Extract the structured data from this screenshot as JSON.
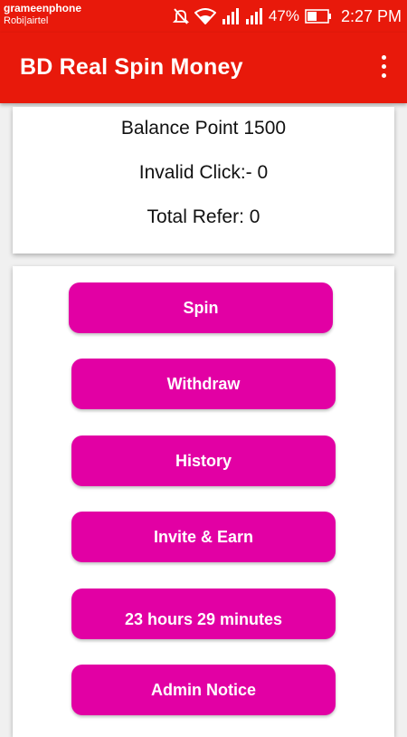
{
  "status_bar": {
    "carrier_primary": "grameenphone",
    "carrier_secondary": "Robi|airtel",
    "battery_percent": "47%",
    "time": "2:27 PM",
    "icons": [
      "mute-icon",
      "wifi-icon",
      "signal-icon",
      "signal-icon",
      "battery-icon"
    ]
  },
  "app_bar": {
    "title": "BD Real Spin Money",
    "menu_icon": "overflow-menu-icon"
  },
  "stats": {
    "balance": "Balance Point 1500",
    "invalid_click": "Invalid Click:- 0",
    "total_refer": "Total Refer: 0"
  },
  "buttons": {
    "spin": "Spin",
    "withdraw": "Withdraw",
    "history": "History",
    "invite": "Invite & Earn",
    "timer": "23 hours 29 minutes",
    "admin_notice": "Admin Notice"
  },
  "colors": {
    "primary": "#e8190b",
    "button": "#e200a4"
  }
}
